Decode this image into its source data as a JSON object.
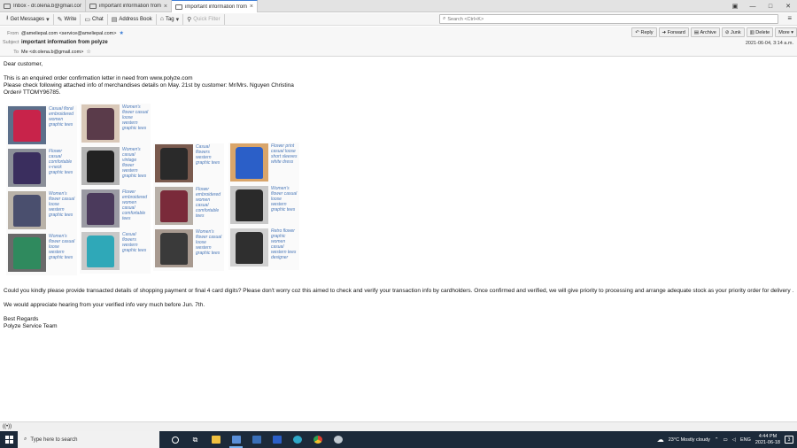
{
  "tabs": [
    {
      "label": "Inbox - dr.olena.b@gmail.com",
      "active": false
    },
    {
      "label": "important information from polyze",
      "active": false
    },
    {
      "label": "important information from polyze",
      "active": true
    }
  ],
  "toolbar": {
    "get_messages": "Get Messages",
    "write": "Write",
    "chat": "Chat",
    "address_book": "Address Book",
    "tag": "Tag",
    "quick_filter": "Quick Filter",
    "search_placeholder": "Search <Ctrl+K>"
  },
  "header": {
    "from_label": "From",
    "from_value": "@ameliepal.com <service@ameliepal.com>",
    "subject_label": "Subject",
    "subject_value": "important information from polyze",
    "to_label": "To",
    "to_value": "Me <dr.olena.b@gmail.com>",
    "date": "2021-06-04, 3:14 a.m.",
    "actions": [
      "Reply",
      "Forward",
      "Archive",
      "Junk",
      "Delete",
      "More"
    ]
  },
  "body": {
    "greeting": "Dear customer,",
    "line1": "This is an enquired order confirmation letter in need from www.polyze.com",
    "line2": "Please check following attached info of merchandises details on May. 21st by customer: Mr/Mrs. Nguyen Christina",
    "line3": "Order# TTOMY96785.",
    "para2": "Could you kindly please provide transacted details of shopping payment or final 4 card digits? Please don't worry coz this aimed to check and verify your transaction info by cardholders. Once confirmed and verified, we will give priority to processing and arrange adequate stock as your priority order for delivery .",
    "para3": "We would appreciate hearing from your verified info very much before Jun. 7th.",
    "sign1": "Best Regards",
    "sign2": "Polyze Service Team"
  },
  "products": [
    {
      "caption": "Casual floral embroidered women graphic tees",
      "shirt": "#c8234a",
      "bg": "#5c6f8a"
    },
    {
      "caption": "Flower casual comfortable v-neck graphic tees",
      "shirt": "#3a2e5e",
      "bg": "#8b8f98"
    },
    {
      "caption": "Women's flower casual loose western graphic tees",
      "shirt": "#4a4f6e",
      "bg": "#b9b2a8"
    },
    {
      "caption": "Women's flower casual loose western graphic tees",
      "shirt": "#2f8a5e",
      "bg": "#6a6a6a"
    },
    {
      "caption": "Women's flower casual loose western graphic tees",
      "shirt": "#5a3b4a",
      "bg": "#d9c8b8"
    },
    {
      "caption": "Women's casual vintage flower western graphic tees",
      "shirt": "#222222",
      "bg": "#b5b5b5"
    },
    {
      "caption": "Flower embroidered women casual comfortable tees",
      "shirt": "#4b3a5c",
      "bg": "#9a9aa3"
    },
    {
      "caption": "Casual flowers western graphic tees",
      "shirt": "#2fa8b8",
      "bg": "#c8c8c8"
    },
    {
      "caption": "Casual flowers western graphic tees",
      "shirt": "#2a2a2a",
      "bg": "#7a5a4e"
    },
    {
      "caption": "Flower embroidered women casual comfortable tees",
      "shirt": "#7a2a3a",
      "bg": "#b8b0a8"
    },
    {
      "caption": "Women's flower casual loose western graphic tees",
      "shirt": "#3a3a3a",
      "bg": "#a89a90"
    },
    {
      "caption": "Flower print casual loose short sleeves white dress",
      "shirt": "#2b5fc8",
      "bg": "#d9a56a"
    },
    {
      "caption": "Women's flower casual loose western graphic tees",
      "shirt": "#2a2a2a",
      "bg": "#c8c8c8"
    },
    {
      "caption": "Retro flower graphic women casual western tees designer",
      "shirt": "#2f2f2f",
      "bg": "#d0d0d0"
    }
  ],
  "statusbar": {
    "icon_text": "((•))"
  },
  "taskbar": {
    "search_placeholder": "Type here to search",
    "weather": "23°C  Mostly cloudy",
    "language": "ENG",
    "time": "4:44 PM",
    "date": "2021-06-18",
    "notifications": "3"
  }
}
